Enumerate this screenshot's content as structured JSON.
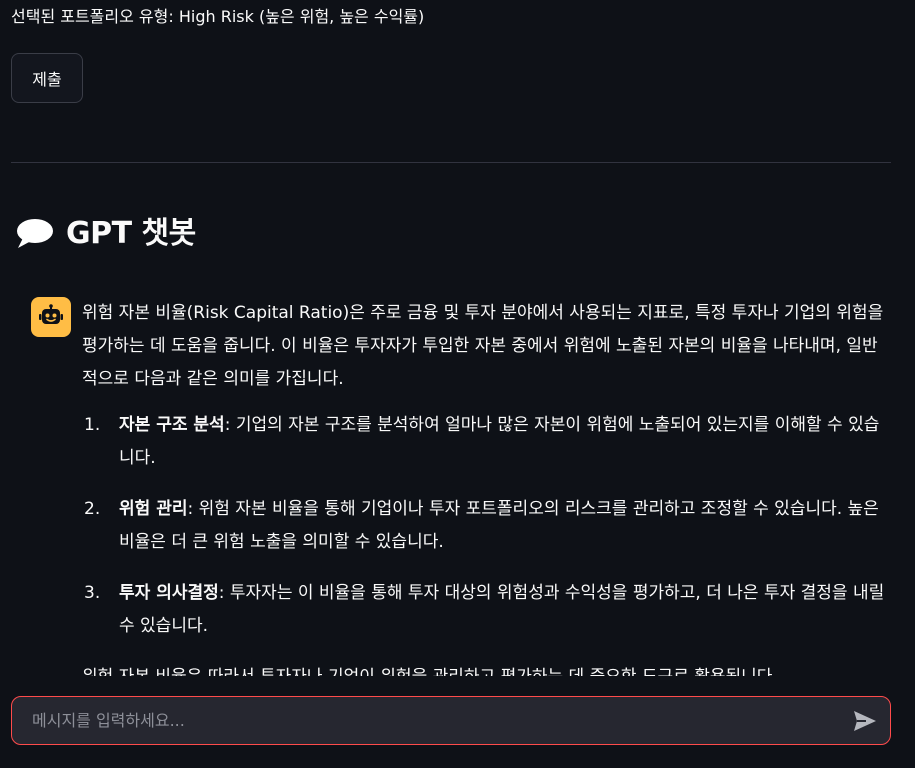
{
  "portfolio": {
    "selected_text": "선택된 포트폴리오 유형: High Risk (높은 위험, 높은 수익률)"
  },
  "form": {
    "submit_label": "제출"
  },
  "chat": {
    "title": "GPT 챗봇",
    "header_icon": "speech-balloon-icon",
    "assistant_avatar_icon": "robot-icon",
    "assistant_message": {
      "intro": "위험 자본 비율(Risk Capital Ratio)은 주로 금융 및 투자 분야에서 사용되는 지표로, 특정 투자나 기업의 위험을 평가하는 데 도움을 줍니다. 이 비율은 투자자가 투입한 자본 중에서 위험에 노출된 자본의 비율을 나타내며, 일반적으로 다음과 같은 의미를 가집니다.",
      "points": [
        {
          "num": "1.",
          "title": "자본 구조 분석",
          "text": ": 기업의 자본 구조를 분석하여 얼마나 많은 자본이 위험에 노출되어 있는지를 이해할 수 있습니다."
        },
        {
          "num": "2.",
          "title": "위험 관리",
          "text": ": 위험 자본 비율을 통해 기업이나 투자 포트폴리오의 리스크를 관리하고 조정할 수 있습니다. 높은 비율은 더 큰 위험 노출을 의미할 수 있습니다."
        },
        {
          "num": "3.",
          "title": "투자 의사결정",
          "text": ": 투자자는 이 비율을 통해 투자 대상의 위험성과 수익성을 평가하고, 더 나은 투자 결정을 내릴 수 있습니다."
        }
      ],
      "conclusion": "위험 자본 비율은 따라서 투자자나 기업이 위험을 관리하고 평가하는 데 중요한 도구로 활용됩니다."
    },
    "input_placeholder": "메시지를 입력하세요...",
    "input_value": ""
  },
  "colors": {
    "background": "#0e1117",
    "accent_border": "#ff4b4b",
    "avatar_bg": "#ffbd45",
    "input_bg": "#262730"
  }
}
